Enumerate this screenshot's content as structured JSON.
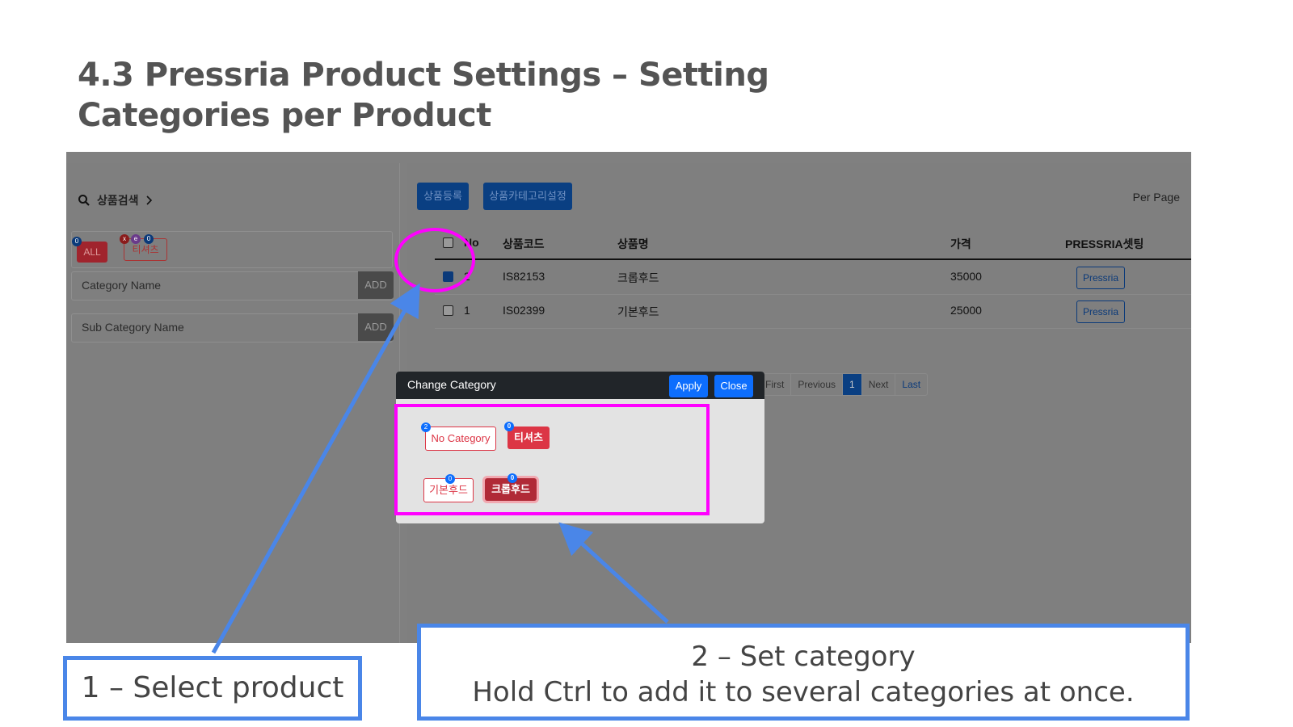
{
  "slide": {
    "title_line1": "4.3  Pressria Product Settings – Setting",
    "title_line2": "Categories per Product"
  },
  "sidebar": {
    "search_label": "상품검색",
    "chip_all": "ALL",
    "chip_all_count": "0",
    "chip_tee": "티셔츠",
    "chip_tee_x": "x",
    "chip_tee_e": "e",
    "chip_tee_count": "0",
    "category_placeholder": "Category Name",
    "category_add": "ADD",
    "subcategory_placeholder": "Sub Category Name",
    "subcategory_add": "ADD"
  },
  "toolbar": {
    "register_label": "상품등록",
    "category_setting_label": "상품카테고리설정",
    "per_page": "Per Page"
  },
  "table": {
    "headers": [
      "No",
      "상품코드",
      "상품명",
      "가격",
      "PRESSRIA셋팅"
    ],
    "rows": [
      {
        "no": "2",
        "code": "IS82153",
        "name": "크롭후드",
        "price": "35000",
        "action": "Pressria",
        "checked": true
      },
      {
        "no": "1",
        "code": "IS02399",
        "name": "기본후드",
        "price": "25000",
        "action": "Pressria",
        "checked": false
      }
    ]
  },
  "pager": {
    "first": "First",
    "previous": "Previous",
    "current": "1",
    "next": "Next",
    "last": "Last"
  },
  "modal": {
    "title": "Change Category",
    "apply": "Apply",
    "close": "Close",
    "categories": [
      {
        "label": "No Category",
        "count": "2"
      },
      {
        "label": "티셔츠",
        "count": "0"
      },
      {
        "label": "기본후드",
        "count": "0"
      },
      {
        "label": "크롭후드",
        "count": "0"
      }
    ]
  },
  "callouts": {
    "step1": "1 – Select product",
    "step2_line1": "2 – Set category",
    "step2_line2": "Hold Ctrl to add it to several categories at once."
  },
  "colors": {
    "highlight": "#ff00ff",
    "callout_border": "#4a86e8",
    "primary": "#0d6efd",
    "danger": "#dc3545"
  }
}
